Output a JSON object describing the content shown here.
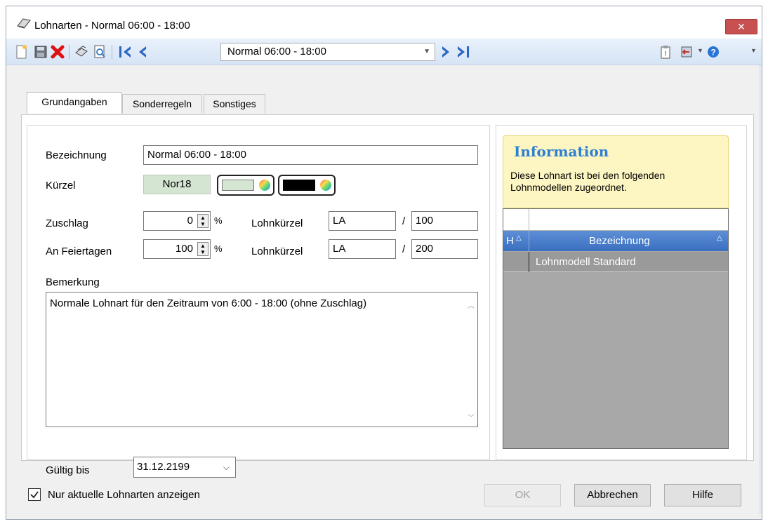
{
  "window": {
    "title": "Lohnarten - Normal 06:00 - 18:00",
    "close_glyph": "✕"
  },
  "toolbar": {
    "record_value": "Normal 06:00 - 18:00"
  },
  "tabs": [
    {
      "label": "Grundangaben",
      "active": true
    },
    {
      "label": "Sonderregeln",
      "active": false
    },
    {
      "label": "Sonstiges",
      "active": false
    }
  ],
  "form": {
    "bezeichnung_label": "Bezeichnung",
    "bezeichnung_value": "Normal 06:00 - 18:00",
    "kuerzel_label": "Kürzel",
    "kuerzel_value": "Nor18",
    "zuschlag_label": "Zuschlag",
    "zuschlag_value": "0",
    "percent": "%",
    "lohnkuerzel_label": "Lohnkürzel",
    "zuschlag_lohn_prefix": "LA",
    "slash": "/",
    "zuschlag_lohn_number": "100",
    "feiertage_label": "An Feiertagen",
    "feiertage_value": "100",
    "feiertage_lohn_prefix": "LA",
    "feiertage_lohn_number": "200",
    "bemerkung_label": "Bemerkung",
    "bemerkung_value": "Normale Lohnart für den Zeitraum von 6:00 - 18:00 (ohne Zuschlag)",
    "gueltig_label": "Gültig bis",
    "gueltig_value": "31.12.2199"
  },
  "info": {
    "title": "Information",
    "text": "Diese Lohnart ist bei den folgenden Lohnmodellen zugeordnet."
  },
  "grid": {
    "col_h": "H",
    "col_bezeichnung": "Bezeichnung",
    "rows": [
      "Lohnmodell Standard"
    ]
  },
  "footer": {
    "checkbox_label": "Nur aktuelle Lohnarten anzeigen",
    "checkbox_checked": true,
    "ok_label": "OK",
    "cancel_label": "Abbrechen",
    "help_label": "Hilfe"
  },
  "colors": {
    "accent_blue": "#3a78c4",
    "info_title": "#2d7fd3",
    "close_red": "#c75050"
  }
}
